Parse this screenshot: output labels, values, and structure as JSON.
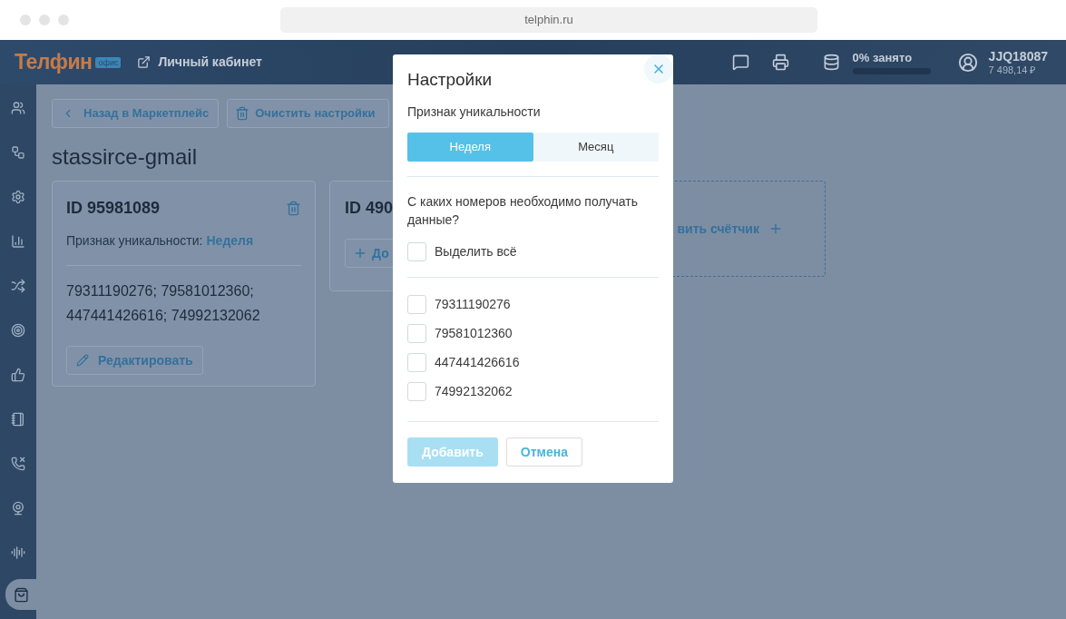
{
  "browser": {
    "url": "telphin.ru"
  },
  "header": {
    "logo": "Телфин",
    "logo_badge": "офис",
    "cabinet_link": "Личный кабинет",
    "storage": {
      "label": "0% занято",
      "level": 0
    },
    "account": {
      "login": "JJQ18087",
      "balance": "7 498,14 ₽"
    }
  },
  "sidebar": {
    "items": [
      {
        "selected": false
      },
      {
        "selected": false
      },
      {
        "selected": false
      },
      {
        "selected": false
      },
      {
        "selected": false
      },
      {
        "selected": false
      },
      {
        "selected": false
      },
      {
        "selected": false
      },
      {
        "selected": false
      },
      {
        "selected": false
      },
      {
        "selected": false
      },
      {
        "selected": true
      }
    ]
  },
  "toolbar": {
    "back_button": "Назад в Маркетплейс",
    "clear_button": "Очистить настройки"
  },
  "page_title": "stassirce-gmail",
  "counters": [
    {
      "id": "ID 95981089",
      "uniqueness_label": "Признак уникальности:",
      "uniqueness_value": "Неделя",
      "numbers": "79311190276; 79581012360; 447441426616; 74992132062",
      "edit_button": "Редактировать"
    },
    {
      "id": "ID 490",
      "add_button": "До"
    }
  ],
  "add_counter": {
    "label": "вить счётчик"
  },
  "dialog": {
    "title": "Настройки",
    "uniqueness_label": "Признак уникальности",
    "tabs": [
      {
        "label": "Неделя",
        "selected": true
      },
      {
        "label": "Месяц",
        "selected": false
      }
    ],
    "question": "С каких номеров необходимо получать данные?",
    "select_all": {
      "label": "Выделить всё",
      "checked": false
    },
    "numbers": [
      {
        "label": "79311190276",
        "checked": false
      },
      {
        "label": "79581012360",
        "checked": false
      },
      {
        "label": "447441426616",
        "checked": false
      },
      {
        "label": "74992132062",
        "checked": false
      }
    ],
    "add_button": {
      "label": "Добавить",
      "disabled": true
    },
    "cancel_button": "Отмена"
  }
}
